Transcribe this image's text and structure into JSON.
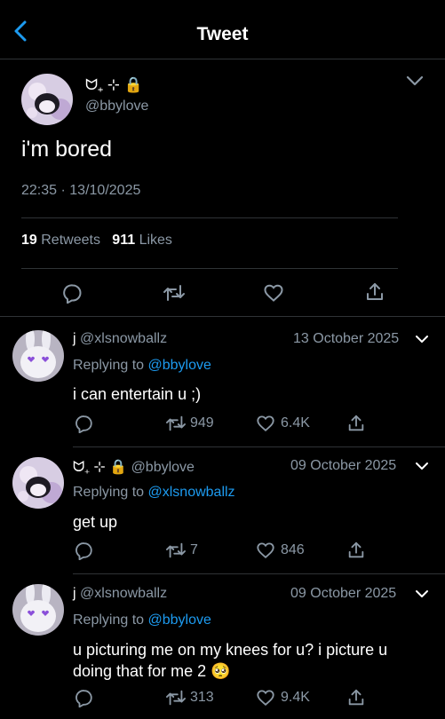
{
  "header": {
    "title": "Tweet",
    "back_icon": "back-chevron-icon"
  },
  "colors": {
    "background": "#000000",
    "link": "#1d9bf0",
    "muted": "#8b98a5",
    "divider": "#2f3336"
  },
  "main_tweet": {
    "display_name": "ᗢ₊ ⊹ 🔒",
    "handle": "@bbylove",
    "text": "i'm bored",
    "time": "22:35",
    "separator": "·",
    "date": "13/10/2025",
    "retweets_count": "19",
    "retweets_label": "Retweets",
    "likes_count": "911",
    "likes_label": "Likes"
  },
  "replies": [
    {
      "display_name": "j",
      "handle": "@xlsnowballz",
      "date": "13 October 2025",
      "replying_prefix": "Replying to",
      "replying_to": "@bbylove",
      "text": "i can entertain u ;)",
      "retweets": "949",
      "likes": "6.4K",
      "avatar": "bunny"
    },
    {
      "display_name": "ᗢ₊ ⊹ 🔒",
      "handle": "@bbylove",
      "date": "09 October 2025",
      "replying_prefix": "Replying to",
      "replying_to": "@xlsnowballz",
      "text": "get up",
      "retweets": "7",
      "likes": "846",
      "avatar": "kuromi"
    },
    {
      "display_name": "j",
      "handle": "@xlsnowballz",
      "date": "09 October 2025",
      "replying_prefix": "Replying to",
      "replying_to": "@bbylove",
      "text": "u picturing me on my knees for u? i picture u doing that for me 2 🥺",
      "retweets": "313",
      "likes": "9.4K",
      "avatar": "bunny"
    }
  ]
}
